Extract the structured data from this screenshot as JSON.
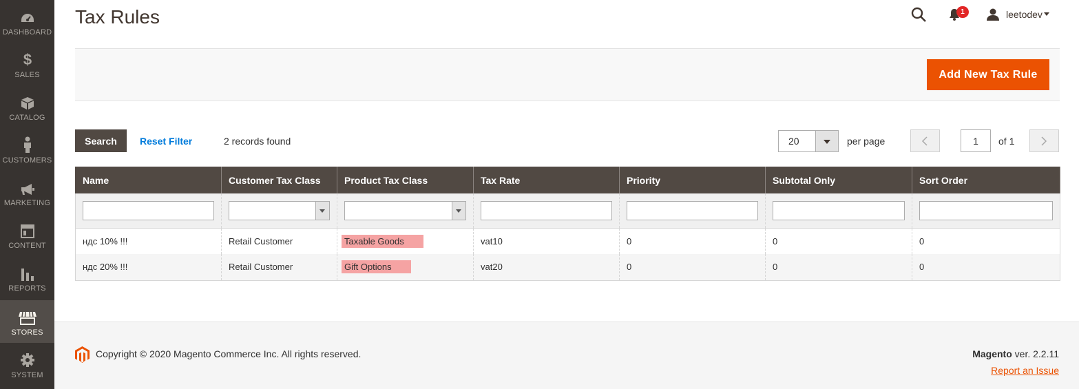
{
  "sidebar": {
    "items": [
      {
        "label": "DASHBOARD",
        "icon": "dashboard-icon"
      },
      {
        "label": "SALES",
        "icon": "dollar-icon"
      },
      {
        "label": "CATALOG",
        "icon": "box-icon"
      },
      {
        "label": "CUSTOMERS",
        "icon": "person-icon"
      },
      {
        "label": "MARKETING",
        "icon": "megaphone-icon"
      },
      {
        "label": "CONTENT",
        "icon": "layout-icon"
      },
      {
        "label": "REPORTS",
        "icon": "bar-chart-icon"
      },
      {
        "label": "STORES",
        "icon": "store-icon",
        "active": true
      },
      {
        "label": "SYSTEM",
        "icon": "gear-icon"
      }
    ]
  },
  "header": {
    "title": "Tax Rules",
    "notifications_count": "1",
    "user_name": "leetodev"
  },
  "actions": {
    "add_label": "Add New Tax Rule"
  },
  "grid": {
    "search_label": "Search",
    "reset_label": "Reset Filter",
    "records_text": "2 records found",
    "per_page_value": "20",
    "per_page_label": "per page",
    "current_page": "1",
    "total_pages_text": "of 1",
    "columns": [
      "Name",
      "Customer Tax Class",
      "Product Tax Class",
      "Tax Rate",
      "Priority",
      "Subtotal Only",
      "Sort Order"
    ],
    "rows": [
      [
        "ндс 10% !!!",
        "Retail Customer",
        "Taxable Goods",
        "vat10",
        "0",
        "0",
        "0"
      ],
      [
        "ндс 20% !!!",
        "Retail Customer",
        "Gift Options",
        "vat20",
        "0",
        "0",
        "0"
      ]
    ],
    "highlight_color": "#f5a3a3"
  },
  "footer": {
    "copyright": "Copyright © 2020 Magento Commerce Inc. All rights reserved.",
    "brand": "Magento",
    "version": " ver. 2.2.11",
    "report_link": "Report an Issue"
  },
  "colors": {
    "accent": "#eb5202",
    "sidebar_bg": "#373330",
    "header_bg": "#514943",
    "link": "#007bdb"
  }
}
